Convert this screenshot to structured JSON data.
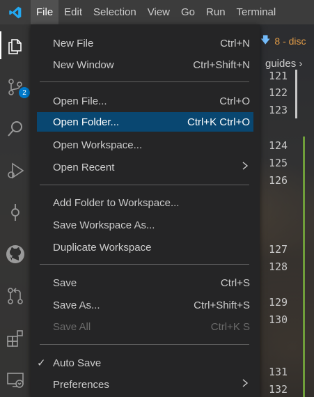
{
  "menubar": {
    "items": [
      "File",
      "Edit",
      "Selection",
      "View",
      "Go",
      "Run",
      "Terminal"
    ]
  },
  "activity": {
    "scm_badge": "2"
  },
  "editor": {
    "tab_label": "8 - disc",
    "breadcrumb": "guides",
    "line_numbers": [
      "121",
      "122",
      "123",
      "124",
      "125",
      "126",
      "127",
      "128",
      "129",
      "130",
      "131",
      "132"
    ]
  },
  "file_menu": {
    "new_file": {
      "label": "New File",
      "accel": "Ctrl+N"
    },
    "new_window": {
      "label": "New Window",
      "accel": "Ctrl+Shift+N"
    },
    "open_file": {
      "label": "Open File...",
      "accel": "Ctrl+O"
    },
    "open_folder": {
      "label": "Open Folder...",
      "accel": "Ctrl+K Ctrl+O"
    },
    "open_workspace": {
      "label": "Open Workspace..."
    },
    "open_recent": {
      "label": "Open Recent"
    },
    "add_folder": {
      "label": "Add Folder to Workspace..."
    },
    "save_workspace_as": {
      "label": "Save Workspace As..."
    },
    "duplicate_workspace": {
      "label": "Duplicate Workspace"
    },
    "save": {
      "label": "Save",
      "accel": "Ctrl+S"
    },
    "save_as": {
      "label": "Save As...",
      "accel": "Ctrl+Shift+S"
    },
    "save_all": {
      "label": "Save All",
      "accel": "Ctrl+K S"
    },
    "auto_save": {
      "label": "Auto Save",
      "checked": true
    },
    "preferences": {
      "label": "Preferences"
    }
  },
  "colors": {
    "selection": "#094771",
    "accent": "#007acc",
    "tab_text": "#e09b47"
  }
}
